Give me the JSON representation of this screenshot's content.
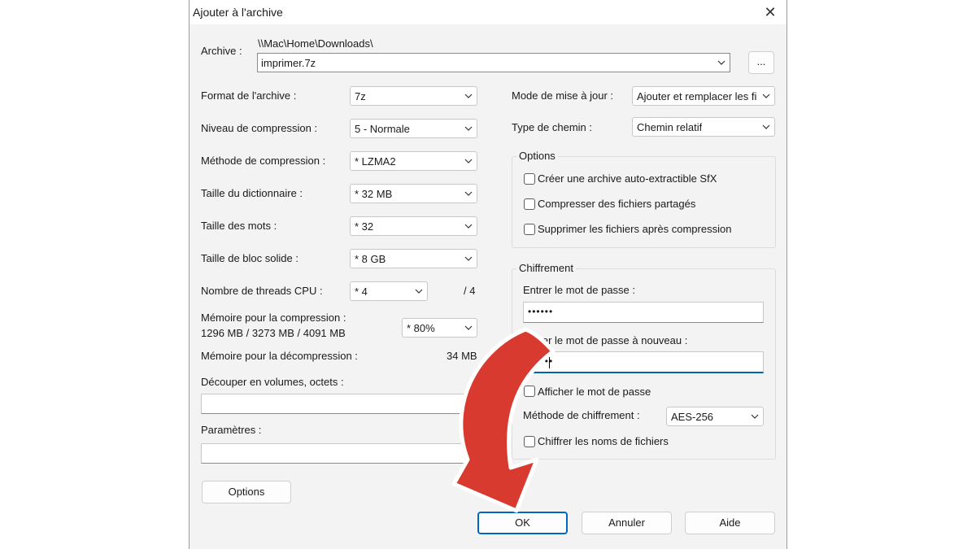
{
  "dialog": {
    "title": "Ajouter à l'archive",
    "close_icon": "✕"
  },
  "archive": {
    "label": "Archive :",
    "path": "\\\\Mac\\Home\\Downloads\\",
    "filename": "imprimer.7z",
    "browse_label": "..."
  },
  "left": {
    "format": {
      "label": "Format de l'archive :",
      "value": "7z"
    },
    "level": {
      "label": "Niveau de compression :",
      "value": "5 - Normale"
    },
    "method": {
      "label": "Méthode de compression :",
      "value": "*  LZMA2"
    },
    "dict": {
      "label": "Taille du dictionnaire :",
      "value": "*  32 MB"
    },
    "words": {
      "label": "Taille des mots :",
      "value": "*  32"
    },
    "block": {
      "label": "Taille de bloc solide :",
      "value": "*  8 GB"
    },
    "threads": {
      "label": "Nombre de threads CPU :",
      "value": "*  4",
      "total": "/ 4"
    },
    "mem_comp": {
      "label": "Mémoire pour la compression :",
      "detail": "1296 MB / 3273 MB / 4091 MB",
      "value": "*  80%"
    },
    "mem_decomp": {
      "label": "Mémoire pour la décompression :",
      "value": "34 MB"
    },
    "split": {
      "label": "Découper en volumes, octets :",
      "value": ""
    },
    "params": {
      "label": "Paramètres :",
      "value": ""
    },
    "options_button": "Options"
  },
  "right": {
    "update_mode": {
      "label": "Mode de mise à jour :",
      "value": "Ajouter et remplacer les fich"
    },
    "path_type": {
      "label": "Type de chemin :",
      "value": "Chemin relatif"
    },
    "options_group": {
      "title": "Options",
      "sfx": "Créer une archive auto-extractible SfX",
      "shared": "Compresser des fichiers partagés",
      "delete": "Supprimer les fichiers après compression"
    },
    "encryption": {
      "title": "Chiffrement",
      "password_label": "Entrer le mot de passe :",
      "password_value": "••••••",
      "password2_label": "Entrer le mot de passe à nouveau :",
      "password2_value": "••••••",
      "show_password": "Afficher le mot de passe",
      "method_label": "Méthode de chiffrement :",
      "method_value": "AES-256",
      "encrypt_names": "Chiffrer les noms de fichiers"
    }
  },
  "buttons": {
    "ok": "OK",
    "cancel": "Annuler",
    "help": "Aide"
  },
  "annotation": {
    "arrow_color": "#d93a2f"
  }
}
